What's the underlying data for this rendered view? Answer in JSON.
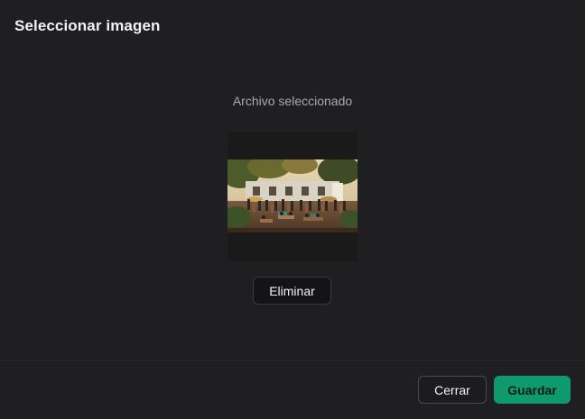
{
  "dialog": {
    "title": "Seleccionar imagen"
  },
  "preview": {
    "label": "Archivo seleccionado",
    "image_icon": "photo-thumbnail",
    "remove_label": "Eliminar"
  },
  "footer": {
    "close_label": "Cerrar",
    "save_label": "Guardar"
  },
  "colors": {
    "background": "#1f1f21",
    "accent": "#0f9a6e",
    "accent_text": "#0b1a14",
    "text_primary": "#f2f2f3",
    "text_muted": "#a9a9ae"
  }
}
